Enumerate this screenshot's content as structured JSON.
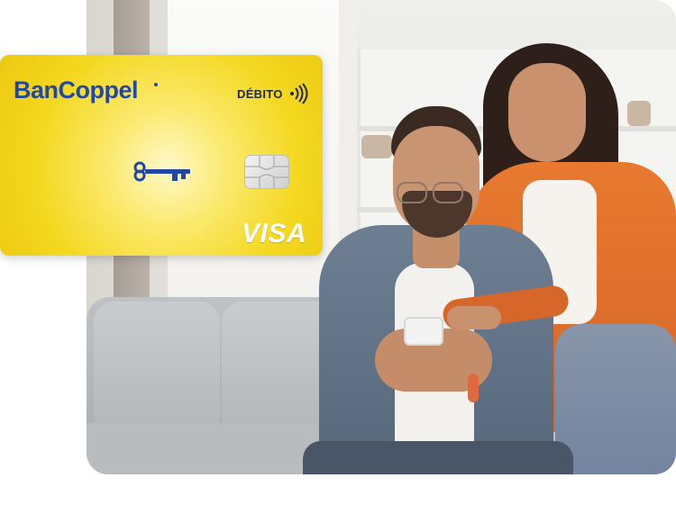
{
  "card": {
    "brand": "BanCoppel",
    "type": "DÉBITO",
    "network": "VISA",
    "background_color": "#f4d820",
    "accent_color": "#2348a3",
    "icons": [
      "contactless-icon",
      "key-logo-icon",
      "chip-icon"
    ]
  },
  "photo": {
    "scene": "person-sofa-smartphone",
    "shirt_color": "#e8792f"
  }
}
